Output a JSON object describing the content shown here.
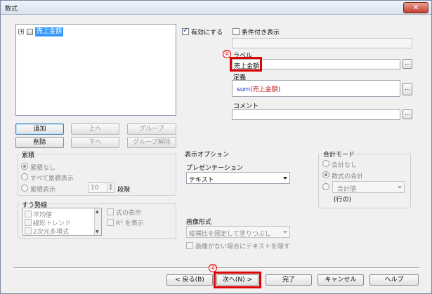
{
  "window": {
    "title": "数式",
    "close_glyph": "✕"
  },
  "tree": {
    "expander": "+",
    "item_label": "売上金額"
  },
  "buttons": {
    "add": "追加",
    "delete": "削除",
    "up": "上へ",
    "down": "下へ",
    "group": "グループ",
    "ungroup": "グループ解除"
  },
  "accumulate": {
    "title": "累積",
    "options": [
      "累積なし",
      "すべて累積表示",
      "累積表示"
    ],
    "selected": "累積なし",
    "steps_value": "10",
    "steps_unit": "段階"
  },
  "trendline": {
    "title": "すう勢線",
    "items": [
      "平均値",
      "線形トレンド",
      "2次元多項式"
    ],
    "show_formula": "式の表示",
    "show_r2": "R² を表示"
  },
  "enable": {
    "label": "有効にする",
    "checked": true
  },
  "conditional": {
    "label": "条件付き表示",
    "checked": false
  },
  "label_field": {
    "caption": "ラベル",
    "value": "売上金額"
  },
  "definition": {
    "caption": "定義",
    "func": "sum(",
    "arg": "売上金額",
    "close": ")"
  },
  "comment": {
    "caption": "コメント",
    "value": ""
  },
  "ellipsis": "...",
  "display_options": {
    "title": "表示オプション",
    "presentation_caption": "プレゼンテーション",
    "presentation_value": "テキスト",
    "image_caption": "画像形式",
    "image_value": "縦横比を固定して塗りつぶし",
    "hide_text": "画像がない場合にテキストを隠す"
  },
  "total_mode": {
    "title": "合計モード",
    "options": [
      "合計なし",
      "数式の合計"
    ],
    "selected": "数式の合計",
    "select_value": "合計値",
    "suffix": "(行の)"
  },
  "footer": {
    "back": "< 戻る(B)",
    "next": "次へ(N) >",
    "finish": "完了",
    "cancel": "キャンセル",
    "help": "ヘルプ"
  },
  "markers": {
    "one": "①",
    "two": "②"
  },
  "colors": {
    "highlight_border": "#e00000",
    "selection": "#3399ff",
    "func_color": "#2030c0",
    "arg_color": "#c02020"
  }
}
